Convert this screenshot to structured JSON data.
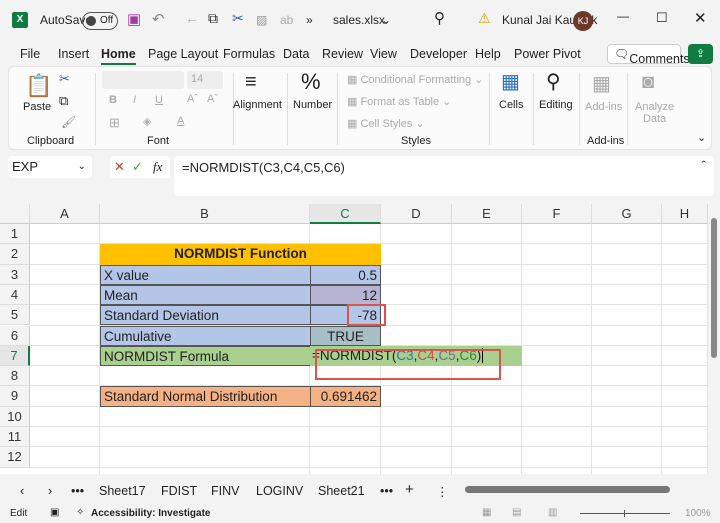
{
  "titlebar": {
    "autosave_label": "AutoSave",
    "autosave_state": "Off",
    "filename": "sales.xlsx",
    "user": "Kunal Jai Kaushik",
    "initials": "KJ",
    "more": "»"
  },
  "menu": [
    "File",
    "Insert",
    "Home",
    "Page Layout",
    "Formulas",
    "Data",
    "Review",
    "View",
    "Developer",
    "Help",
    "Power Pivot"
  ],
  "menu_active": "Home",
  "comments_label": "Comments",
  "ribbon": {
    "paste": "Paste",
    "clipboard": "Clipboard",
    "font_size": "14",
    "font": "Font",
    "bold": "B",
    "italic": "I",
    "underline": "U",
    "alignment": "Alignment",
    "number": "Number",
    "cond_fmt": "Conditional Formatting",
    "fmt_table": "Format as Table",
    "cell_styles": "Cell Styles",
    "styles": "Styles",
    "cells": "Cells",
    "editing": "Editing",
    "addins": "Add-ins",
    "addins_group": "Add-ins",
    "analyze": "Analyze",
    "analyze2": "Data",
    "percent": "%"
  },
  "formula_bar": {
    "name_box": "EXP",
    "cancel": "✕",
    "enter": "✓",
    "fx": "fx",
    "formula": "=NORMDIST(C3,C4,C5,C6)"
  },
  "columns": [
    "A",
    "B",
    "C",
    "D",
    "E",
    "F",
    "G",
    "H"
  ],
  "rows": [
    "1",
    "2",
    "3",
    "4",
    "5",
    "6",
    "7",
    "8",
    "9",
    "10",
    "11",
    "12"
  ],
  "sheet": {
    "title": "NORMDIST Function",
    "labels": [
      "X value",
      "Mean",
      "Standard Deviation",
      "Cumulative",
      "NORMDIST Formula"
    ],
    "values": [
      "0.5",
      "12",
      "-78",
      "TRUE"
    ],
    "formula_parts": [
      "=NORMDIST(",
      "C3",
      ",",
      "C4",
      ",",
      "C5",
      ",",
      "C6",
      ")"
    ],
    "result_label": "Standard Normal Distribution",
    "result_value": "0.691462"
  },
  "colors": {
    "title_bg": "#ffc000",
    "blue_bg": "#b4c6e7",
    "green_bg": "#a9d08e",
    "orange_bg": "#f4b183",
    "highlight_red": "#d9534f",
    "excel_green": "#107c41"
  },
  "sheet_tabs": [
    "Sheet17",
    "FDIST",
    "FINV",
    "LOGINV",
    "Sheet21"
  ],
  "status": {
    "mode": "Edit",
    "accessibility": "Accessibility: Investigate",
    "zoom": "100%"
  }
}
